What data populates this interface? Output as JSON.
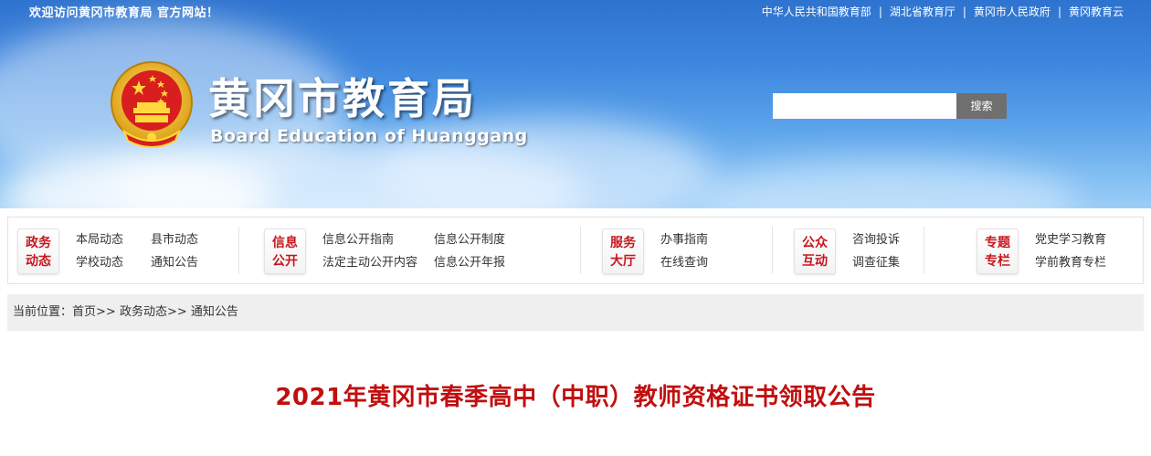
{
  "header": {
    "welcome": "欢迎访问黄冈市教育局 官方网站！",
    "links": [
      "中华人民共和国教育部",
      "湖北省教育厅",
      "黄冈市人民政府",
      "黄冈教育云"
    ],
    "separator": "|",
    "title": "黄冈市教育局",
    "subtitle": "Board Education of Huanggang",
    "search_placeholder": "",
    "search_button": "搜索"
  },
  "nav": {
    "groups": [
      {
        "badge_line1": "政务",
        "badge_line2": "动态",
        "links": [
          "本局动态",
          "学校动态",
          "县市动态",
          "通知公告"
        ]
      },
      {
        "badge_line1": "信息",
        "badge_line2": "公开",
        "links": [
          "信息公开指南",
          "法定主动公开内容",
          "信息公开制度",
          "信息公开年报"
        ]
      },
      {
        "badge_line1": "服务",
        "badge_line2": "大厅",
        "links": [
          "办事指南",
          "在线查询"
        ]
      },
      {
        "badge_line1": "公众",
        "badge_line2": "互动",
        "links": [
          "咨询投诉",
          "调查征集"
        ]
      },
      {
        "badge_line1": "专题",
        "badge_line2": "专栏",
        "links": [
          "党史学习教育",
          "学前教育专栏"
        ]
      }
    ]
  },
  "breadcrumb": {
    "prefix": "当前位置：",
    "items": [
      "首页",
      "政务动态",
      "通知公告"
    ],
    "separator": ">>"
  },
  "article": {
    "title": "2021年黄冈市春季高中（中职）教师资格证书领取公告"
  },
  "colors": {
    "accent_red": "#c00f0f",
    "banner_blue": "#3d86de",
    "search_button_bg": "#6f6f6f",
    "breadcrumb_bg": "#efefef"
  }
}
